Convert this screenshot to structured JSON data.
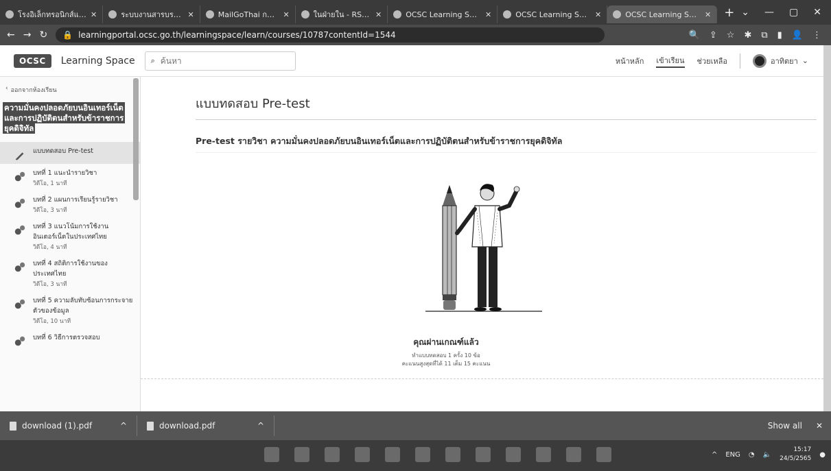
{
  "browser": {
    "tabs": [
      {
        "title": "โรงอิเล็กทรอนิกส์และ"
      },
      {
        "title": "ระบบงานสารบรรณ"
      },
      {
        "title": "MailGoThai กล่อง"
      },
      {
        "title": "ในฝ่ายใน - RSPD"
      },
      {
        "title": "OCSC Learning Space"
      },
      {
        "title": "OCSC Learning Space"
      },
      {
        "title": "OCSC Learning Space",
        "active": true
      }
    ],
    "new_tab": "+",
    "url": "learningportal.ocsc.go.th/learningspace/learn/courses/10787contentId=1544"
  },
  "header": {
    "logo": "OCSC",
    "brand": "Learning Space",
    "search_placeholder": "ค้นหา",
    "nav": [
      {
        "label": "หน้าหลัก"
      },
      {
        "label": "เข้าเรียน",
        "active": true
      },
      {
        "label": "ช่วยเหลือ"
      }
    ],
    "user": "อาทิตยา"
  },
  "sidebar": {
    "back_label": "ออกจากห้องเรียน",
    "course_title": "ความมั่นคงปลอดภัยบนอินเทอร์เน็ตและการปฏิบัติตนสำหรับข้าราชการยุคดิจิทัล",
    "lessons": [
      {
        "title": "แบบทดสอบ Pre-test",
        "sub": "",
        "active": true
      },
      {
        "title": "บทที่ 1 แนะนำรายวิชา",
        "sub": "วิดีโอ, 1 นาที"
      },
      {
        "title": "บทที่ 2 แผนการเรียนรู้รายวิชา",
        "sub": "วิดีโอ, 3 นาที"
      },
      {
        "title": "บทที่ 3 แนวโน้มการใช้งานอินเตอร์เน็ตในประเทศไทย",
        "sub": "วิดีโอ, 4 นาที"
      },
      {
        "title": "บทที่ 4 สถิติการใช้งานของประเทศไทย",
        "sub": "วิดีโอ, 3 นาที"
      },
      {
        "title": "บทที่ 5 ความลับทับซ้อนการกระจายตัวของข้อมูล",
        "sub": "วิดีโอ, 10 นาที"
      },
      {
        "title": "บทที่ 6 วิธีการตรวจสอบ",
        "sub": ""
      }
    ]
  },
  "main": {
    "page_title": "แบบทดสอบ Pre-test",
    "subtitle": "Pre-test รายวิชา ความมั่นคงปลอดภัยบนอินเทอร์เน็ตและการปฏิบัติตนสำหรับข้าราชการยุคดิจิทัล",
    "passed": "คุณผ่านเกณฑ์แล้ว",
    "info_line1": "ทำแบบทดสอบ 1 ครั้ง 10 ข้อ",
    "info_line2": "คะแนนสูงสุดที่ได้ 11 เต็ม 15 คะแนน"
  },
  "downloads": {
    "items": [
      {
        "name": "download (1).pdf"
      },
      {
        "name": "download.pdf"
      }
    ],
    "show_all": "Show all"
  },
  "taskbar": {
    "lang": "ENG",
    "time": "15:17",
    "date": "24/5/2565"
  }
}
